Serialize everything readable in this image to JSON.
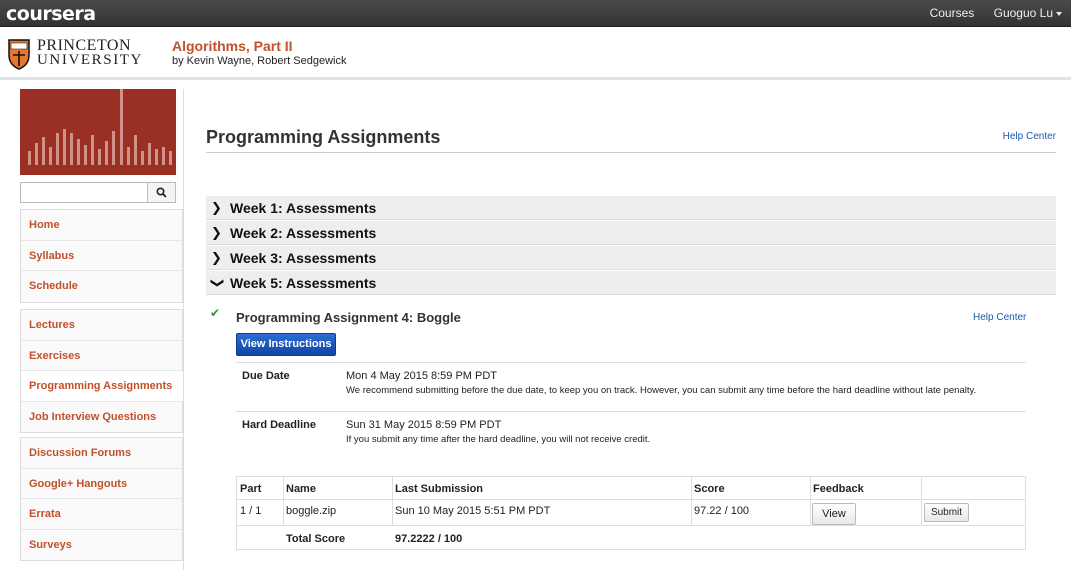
{
  "topbar": {
    "brand": "coursera",
    "courses_label": "Courses",
    "user_label": "Guoguo Lu"
  },
  "header": {
    "university_line1": "PRINCETON",
    "university_line2": "UNIVERSITY",
    "course_title": "Algorithms, Part II",
    "course_authors": "by Kevin Wayne, Robert Sedgewick"
  },
  "colors": {
    "brand_orange": "#c2502a",
    "banner_red": "#9a2f24",
    "link_blue": "#1a5aa8",
    "button_blue": "#1a55c0",
    "check_green": "#2a9a2a"
  },
  "sidebar": {
    "search_placeholder": "",
    "search_icon": "search-icon",
    "groups": [
      {
        "items": [
          {
            "label": "Home"
          },
          {
            "label": "Syllabus"
          },
          {
            "label": "Schedule"
          }
        ]
      },
      {
        "items": [
          {
            "label": "Lectures"
          },
          {
            "label": "Exercises"
          },
          {
            "label": "Programming Assignments",
            "active": true
          },
          {
            "label": "Job Interview Questions"
          }
        ]
      },
      {
        "items": [
          {
            "label": "Discussion Forums"
          },
          {
            "label": "Google+ Hangouts"
          },
          {
            "label": "Errata"
          },
          {
            "label": "Surveys"
          }
        ]
      }
    ]
  },
  "main": {
    "page_title": "Programming Assignments",
    "help_center": "Help Center",
    "weeks": [
      {
        "label": "Week 1: Assessments",
        "expanded": false
      },
      {
        "label": "Week 2: Assessments",
        "expanded": false
      },
      {
        "label": "Week 3: Assessments",
        "expanded": false
      },
      {
        "label": "Week 5: Assessments",
        "expanded": true
      }
    ],
    "assignment": {
      "title": "Programming Assignment 4: Boggle",
      "help_center": "Help Center",
      "view_instructions": "View Instructions",
      "due_label": "Due Date",
      "due_value": "Mon 4 May 2015 8:59 PM PDT",
      "due_note": "We recommend submitting before the due date, to keep you on track. However, you can submit any time before the hard deadline without late penalty.",
      "hard_label": "Hard Deadline",
      "hard_value": "Sun 31 May 2015 8:59 PM PDT",
      "hard_note": "If you submit any time after the hard deadline, you will not receive credit.",
      "table": {
        "headers": [
          "Part",
          "Name",
          "Last Submission",
          "Score",
          "Feedback"
        ],
        "row": {
          "part": "1 / 1",
          "name": "boggle.zip",
          "last_submission": "Sun 10 May 2015 5:51 PM PDT",
          "score": "97.22 / 100",
          "view": "View",
          "submit": "Submit"
        },
        "total_label": "Total Score",
        "total_value": "97.2222 / 100"
      }
    }
  }
}
